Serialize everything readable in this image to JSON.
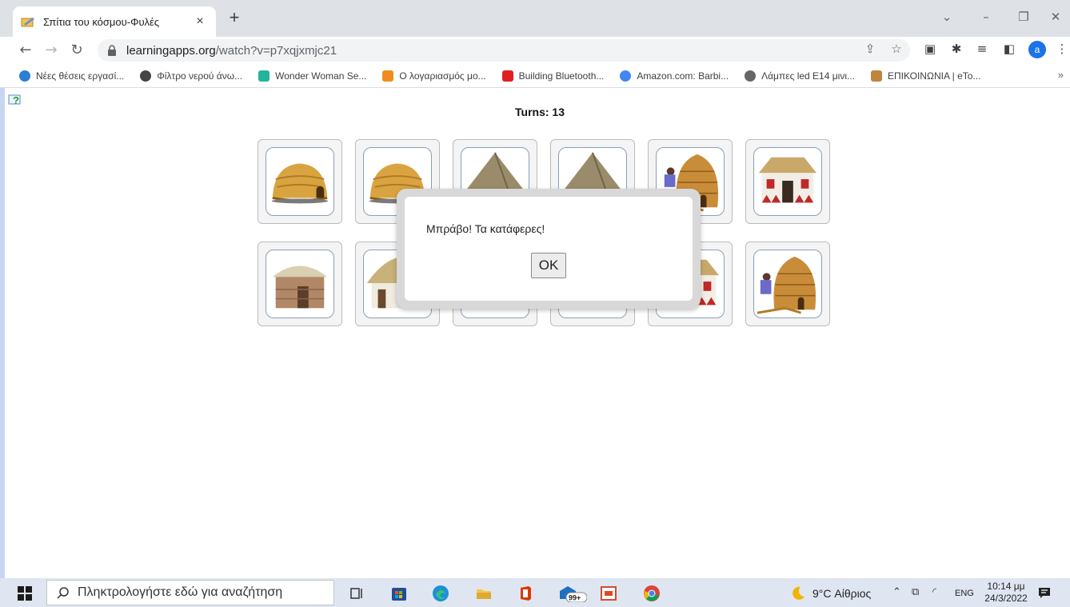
{
  "browser": {
    "tab_title": "Σπίτια του κόσμου-Φυλές",
    "tab_close": "×",
    "new_tab": "+",
    "url_domain": "learningapps.org",
    "url_path": "/watch?v=p7xqjxmjc21",
    "profile_initial": "a",
    "bookmarks": [
      {
        "label": "Νέες θέσεις εργασί...",
        "color": "#2d7fd3"
      },
      {
        "label": "Φίλτρο νερού άνω...",
        "color": "#444444"
      },
      {
        "label": "Wonder Woman Se...",
        "color": "#23b59a"
      },
      {
        "label": "Ο λογαριασμός μο...",
        "color": "#f08c1e"
      },
      {
        "label": "Building Bluetooth...",
        "color": "#e02020"
      },
      {
        "label": "Amazon.com: Barbi...",
        "color": "#4285f4"
      },
      {
        "label": "Λάμπες led E14 μινι...",
        "color": "#666666"
      },
      {
        "label": "ΕΠΙΚΟΙΝΩΝΙΑ | eTo...",
        "color": "#c0843a"
      }
    ],
    "bookmarks_more": "»"
  },
  "game": {
    "turns_text": "Turns: 13",
    "cards_row1": [
      "dome-hut",
      "dome-hut",
      "conical-hut",
      "conical-hut",
      "beehive-hut-with-woman",
      "painted-house"
    ],
    "cards_row2": [
      "round-hut",
      "thatched-house",
      "hidden",
      "hidden",
      "painted-house",
      "beehive-hut-with-woman"
    ]
  },
  "dialog": {
    "message": "Μπράβο! Τα κατάφερες!",
    "ok_label": "OK"
  },
  "taskbar": {
    "search_placeholder": "Πληκτρολογήστε εδώ για αναζήτηση",
    "mail_badge": "99+",
    "weather": "9°C  Αίθριος",
    "language": "ENG",
    "time": "10:14 μμ",
    "date": "24/3/2022"
  },
  "colors": {
    "accent": "#1a73e8",
    "desktop": "#c9d6f0"
  }
}
